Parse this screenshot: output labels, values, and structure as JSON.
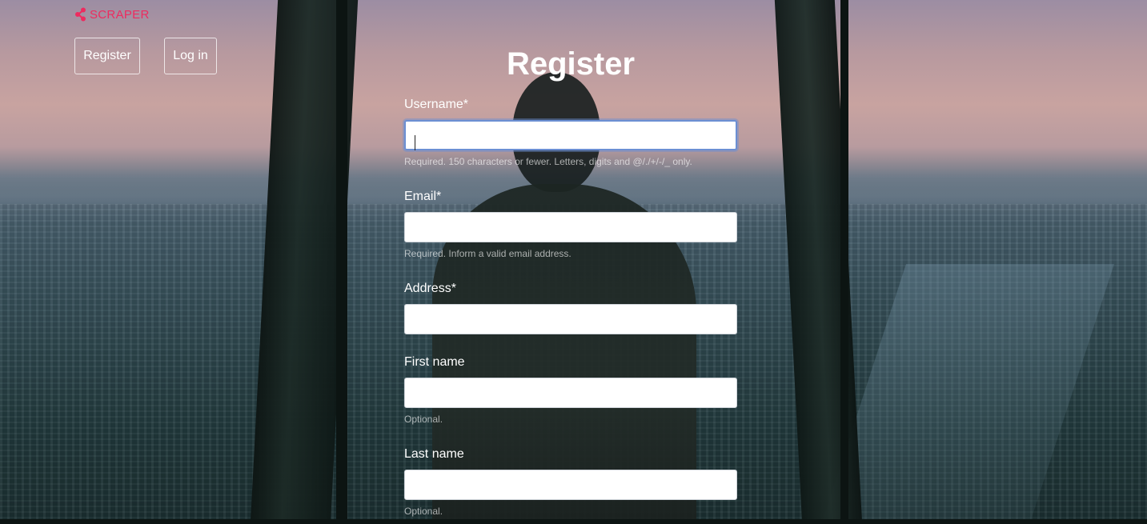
{
  "brand": {
    "name": "SCRAPER",
    "icon": "share-nodes-icon",
    "color": "#ee2b5f"
  },
  "nav": {
    "register_label": "Register",
    "login_label": "Log in"
  },
  "form": {
    "title": "Register",
    "fields": [
      {
        "label": "Username*",
        "value": "",
        "placeholder": "",
        "help": "Required. 150 characters or fewer. Letters, digits and @/./+/-/_ only."
      },
      {
        "label": "Email*",
        "value": "",
        "placeholder": "",
        "help": "Required. Inform a valid email address."
      },
      {
        "label": "Address*",
        "value": "",
        "placeholder": ""
      },
      {
        "label": "First name",
        "value": "",
        "placeholder": "",
        "help": "Optional."
      },
      {
        "label": "Last name",
        "value": "",
        "placeholder": "",
        "help": "Optional."
      }
    ]
  },
  "colors": {
    "focus_ring": "#6b8fd3",
    "text": "#ffffff"
  }
}
